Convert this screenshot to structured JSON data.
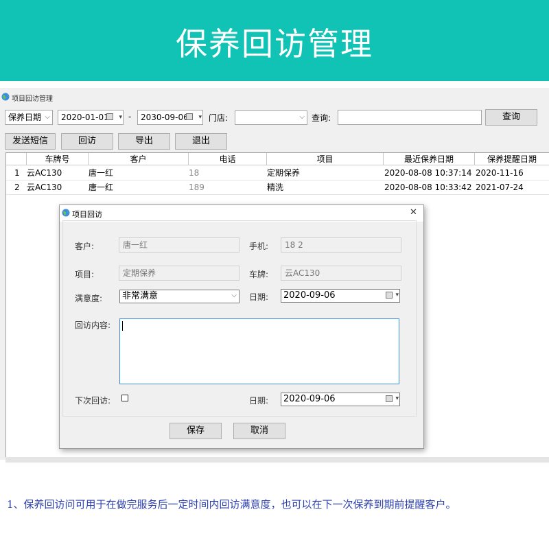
{
  "banner": {
    "title": "保养回访管理"
  },
  "window": {
    "title": "项目回访管理"
  },
  "toolbar": {
    "date_type": "保养日期",
    "date_from": "2020-01-01",
    "date_sep": "-",
    "date_to": "2030-09-06",
    "store_label": "门店:",
    "store_value": "",
    "search_label": "查询:",
    "search_value": "",
    "search_button": "查询",
    "buttons": {
      "sms": "发送短信",
      "visit": "回访",
      "export": "导出",
      "exit": "退出"
    }
  },
  "table": {
    "columns": [
      "车牌号",
      "客户",
      "电话",
      "项目",
      "最近保养日期",
      "保养提醒日期"
    ],
    "rows": [
      {
        "index": "1",
        "plate": "云AC130",
        "customer": "唐一红",
        "phone": "18",
        "item": "定期保养",
        "last_date": "2020-08-08 10:37:14",
        "remind_date": "2020-11-16"
      },
      {
        "index": "2",
        "plate": "云AC130",
        "customer": "唐一红",
        "phone": "189",
        "item": "精洗",
        "last_date": "2020-08-08 10:33:42",
        "remind_date": "2021-07-24"
      }
    ]
  },
  "dialog": {
    "title": "项目回访",
    "close": "✕",
    "customer_label": "客户:",
    "customer_value": "唐一红",
    "phone_label": "手机:",
    "phone_value": "18      2",
    "item_label": "项目:",
    "item_value": "定期保养",
    "plate_label": "车牌:",
    "plate_value": "云AC130",
    "satisfaction_label": "满意度:",
    "satisfaction_value": "非常满意",
    "date_label": "日期:",
    "date_value": "2020-09-06",
    "content_label": "回访内容:",
    "content_value": "",
    "next_visit_label": "下次回访:",
    "next_date_label": "日期:",
    "next_date_value": "2020-09-06",
    "save_button": "保存",
    "cancel_button": "取消"
  },
  "footer_note": "1、保养回访问可用于在做完服务后一定时间内回访满意度，也可以在下一次保养到期前提醒客户。",
  "colors": {
    "banner": "#10c3b4",
    "note": "#2c3fb0"
  }
}
